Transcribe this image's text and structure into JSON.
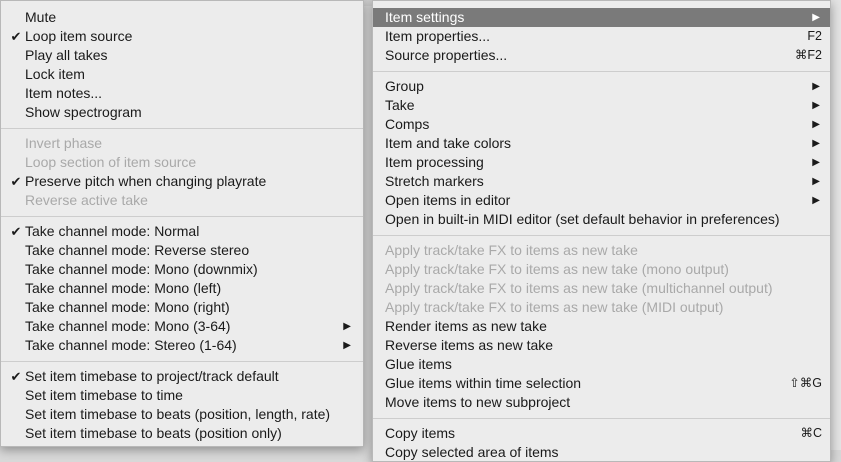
{
  "left_menu": {
    "groups": [
      [
        {
          "label": "Mute",
          "checked": false,
          "disabled": false
        },
        {
          "label": "Loop item source",
          "checked": true,
          "disabled": false
        },
        {
          "label": "Play all takes",
          "checked": false,
          "disabled": false
        },
        {
          "label": "Lock item",
          "checked": false,
          "disabled": false
        },
        {
          "label": "Item notes...",
          "checked": false,
          "disabled": false
        },
        {
          "label": "Show spectrogram",
          "checked": false,
          "disabled": false
        }
      ],
      [
        {
          "label": "Invert phase",
          "checked": false,
          "disabled": true
        },
        {
          "label": "Loop section of item source",
          "checked": false,
          "disabled": true
        },
        {
          "label": "Preserve pitch when changing playrate",
          "checked": true,
          "disabled": false
        },
        {
          "label": "Reverse active take",
          "checked": false,
          "disabled": true
        }
      ],
      [
        {
          "label": "Take channel mode: Normal",
          "checked": true,
          "disabled": false
        },
        {
          "label": "Take channel mode: Reverse stereo",
          "checked": false,
          "disabled": false
        },
        {
          "label": "Take channel mode: Mono (downmix)",
          "checked": false,
          "disabled": false
        },
        {
          "label": "Take channel mode: Mono (left)",
          "checked": false,
          "disabled": false
        },
        {
          "label": "Take channel mode: Mono (right)",
          "checked": false,
          "disabled": false
        },
        {
          "label": "Take channel mode: Mono (3-64)",
          "checked": false,
          "disabled": false,
          "submenu": true
        },
        {
          "label": "Take channel mode: Stereo (1-64)",
          "checked": false,
          "disabled": false,
          "submenu": true
        }
      ],
      [
        {
          "label": "Set item timebase to project/track default",
          "checked": true,
          "disabled": false
        },
        {
          "label": "Set item timebase to time",
          "checked": false,
          "disabled": false
        },
        {
          "label": "Set item timebase to beats (position, length, rate)",
          "checked": false,
          "disabled": false
        },
        {
          "label": "Set item timebase to beats (position only)",
          "checked": false,
          "disabled": false
        }
      ]
    ]
  },
  "right_menu": {
    "groups": [
      [
        {
          "label": "Item settings",
          "submenu": true,
          "highlight": true
        },
        {
          "label": "Item properties...",
          "shortcut": "F2"
        },
        {
          "label": "Source properties...",
          "shortcut": "⌘F2"
        }
      ],
      [
        {
          "label": "Group",
          "submenu": true
        },
        {
          "label": "Take",
          "submenu": true
        },
        {
          "label": "Comps",
          "submenu": true
        },
        {
          "label": "Item and take colors",
          "submenu": true
        },
        {
          "label": "Item processing",
          "submenu": true
        },
        {
          "label": "Stretch markers",
          "submenu": true
        },
        {
          "label": "Open items in editor",
          "submenu": true
        },
        {
          "label": "Open in built-in MIDI editor (set default behavior in preferences)"
        }
      ],
      [
        {
          "label": "Apply track/take FX to items as new take",
          "disabled": true
        },
        {
          "label": "Apply track/take FX to items as new take (mono output)",
          "disabled": true
        },
        {
          "label": "Apply track/take FX to items as new take (multichannel output)",
          "disabled": true
        },
        {
          "label": "Apply track/take FX to items as new take (MIDI output)",
          "disabled": true
        },
        {
          "label": "Render items as new take"
        },
        {
          "label": "Reverse items as new take"
        },
        {
          "label": "Glue items"
        },
        {
          "label": "Glue items within time selection",
          "shortcut": "⇧⌘G"
        },
        {
          "label": "Move items to new subproject"
        }
      ],
      [
        {
          "label": "Copy items",
          "shortcut": "⌘C"
        },
        {
          "label": "Copy selected area of items"
        }
      ]
    ]
  },
  "icons": {
    "check": "checkmark-icon",
    "submenu": "submenu-arrow-icon"
  }
}
